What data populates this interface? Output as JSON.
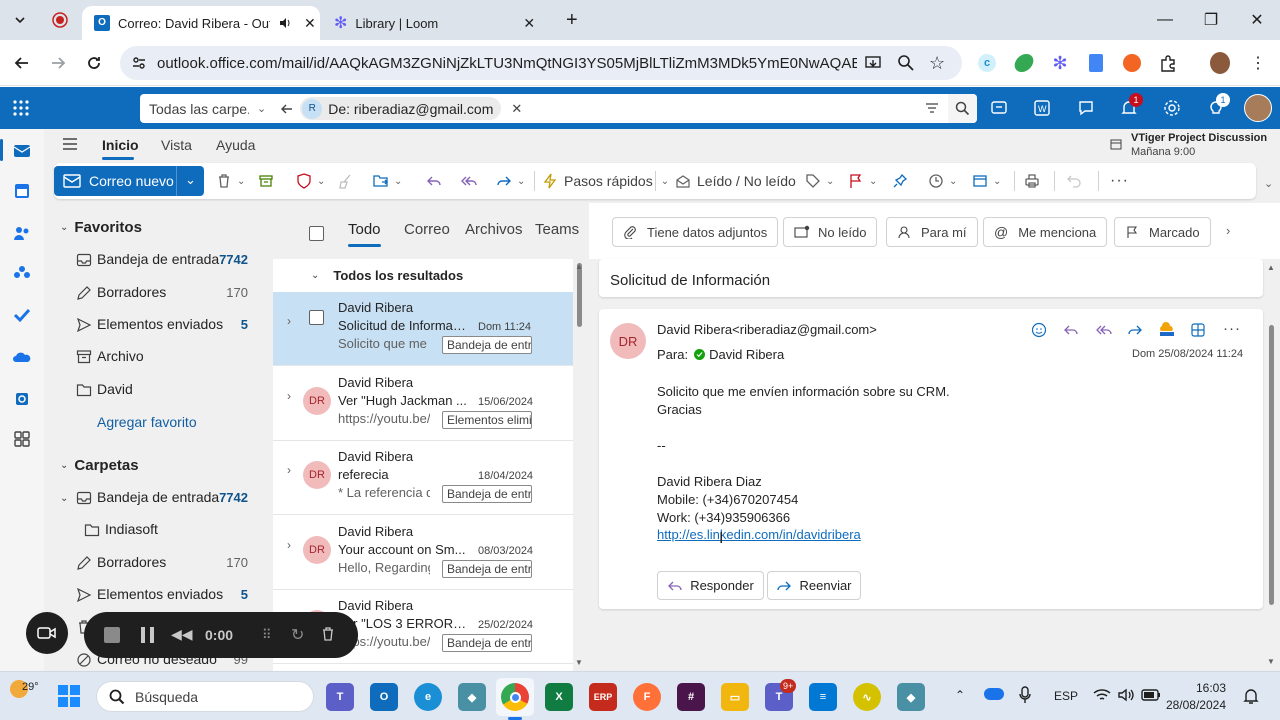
{
  "browser": {
    "tabs": [
      {
        "title": "Correo: David Ribera - Outlook"
      },
      {
        "title": "Library | Loom"
      }
    ],
    "url": "outlook.office.com/mail/id/AAQkAGM3ZGNiNjZkLTU3NmQtNGI3YS05MjBlLTliZmM3MDk5YmE0NwAQABMWF..."
  },
  "outlook": {
    "search": {
      "scope": "Todas las carpe...",
      "chip_initial": "R",
      "chip_label": "De: riberadiaz@gmail.com"
    },
    "header_badges": {
      "notifications": "1",
      "tips": "1"
    },
    "ribbon_tabs": [
      "Inicio",
      "Vista",
      "Ayuda"
    ],
    "upcoming": {
      "title": "VTiger Project Discussion",
      "time": "Mañana 9:00"
    },
    "ribbon": {
      "new_mail": "Correo nuevo",
      "quick_steps": "Pasos rápidos",
      "read_unread": "Leído / No leído"
    },
    "folders": {
      "favorites_title": "Favoritos",
      "favorites": [
        {
          "name": "Bandeja de entrada",
          "count": "7742",
          "icon": "inbox-icon"
        },
        {
          "name": "Borradores",
          "count": "170",
          "icon": "drafts-icon"
        },
        {
          "name": "Elementos enviados",
          "count": "5",
          "icon": "sent-icon"
        },
        {
          "name": "Archivo",
          "count": "",
          "icon": "archive-icon"
        },
        {
          "name": "David",
          "count": "",
          "icon": "folder-icon"
        }
      ],
      "add_favorite": "Agregar favorito",
      "folders_title": "Carpetas",
      "folders": [
        {
          "name": "Bandeja de entrada",
          "count": "7742",
          "icon": "inbox-icon"
        },
        {
          "name": "Indiasoft",
          "count": "",
          "icon": "folder-icon"
        },
        {
          "name": "Borradores",
          "count": "170",
          "icon": "drafts-icon"
        },
        {
          "name": "Elementos enviados",
          "count": "5",
          "icon": "sent-icon"
        },
        {
          "name": "Elementos eliminados",
          "count": "",
          "icon": "trash-icon"
        },
        {
          "name": "Correo no deseado",
          "count": "99",
          "icon": "junk-icon"
        }
      ]
    },
    "filter_tabs": [
      "Todo",
      "Correo",
      "Archivos",
      "Teams"
    ],
    "filter_buttons": [
      "Tiene datos adjuntos",
      "No leído",
      "Para mí",
      "Me menciona",
      "Marcado"
    ],
    "list_header": "Todos los resultados",
    "messages": [
      {
        "sender": "David Ribera",
        "subject": "Solicitud de Información",
        "date": "Dom 11:24",
        "preview": "Solicito que me envíen información",
        "tag": "Bandeja de entrada",
        "initials": "",
        "selected": true
      },
      {
        "sender": "David Ribera",
        "subject": "Ver \"Hugh Jackman ...",
        "date": "15/06/2024",
        "preview": "https://youtu.be/",
        "tag": "Elementos eliminados",
        "initials": "DR",
        "selected": false
      },
      {
        "sender": "David Ribera",
        "subject": "referecia",
        "date": "18/04/2024",
        "preview": "* La referencia de",
        "tag": "Bandeja de entrada",
        "initials": "DR",
        "selected": false
      },
      {
        "sender": "David Ribera",
        "subject": "Your account on Sm...",
        "date": "08/03/2024",
        "preview": "Hello, Regarding",
        "tag": "Bandeja de entrada",
        "initials": "DR",
        "selected": false
      },
      {
        "sender": "David Ribera",
        "subject": "Ver \"LOS 3 ERRORES...",
        "date": "25/02/2024",
        "preview": "https://youtu.be/",
        "tag": "Bandeja de entrada",
        "initials": "DR",
        "selected": false
      }
    ],
    "reading": {
      "subject": "Solicitud de Información",
      "avatar": "DR",
      "from": "David Ribera<riberadiaz@gmail.com>",
      "to_label": "Para:",
      "to": "David Ribera",
      "date": "Dom 25/08/2024 11:24",
      "body": [
        "Solicito que me envíen información sobre su CRM.",
        "Gracias",
        "",
        "--",
        "",
        "David Ribera Diaz",
        "Mobile: (+34)670207454",
        "Work: (+34)935906366"
      ],
      "link": "http://es.linkedin.com/in/davidribera",
      "reply": "Responder",
      "forward": "Reenviar"
    }
  },
  "loom": {
    "timer": "0:00"
  },
  "taskbar": {
    "temperature": "29°",
    "search_placeholder": "Búsqueda",
    "teams_badge": "9+",
    "language": "ESP",
    "time": "16:03",
    "date": "28/08/2024"
  }
}
